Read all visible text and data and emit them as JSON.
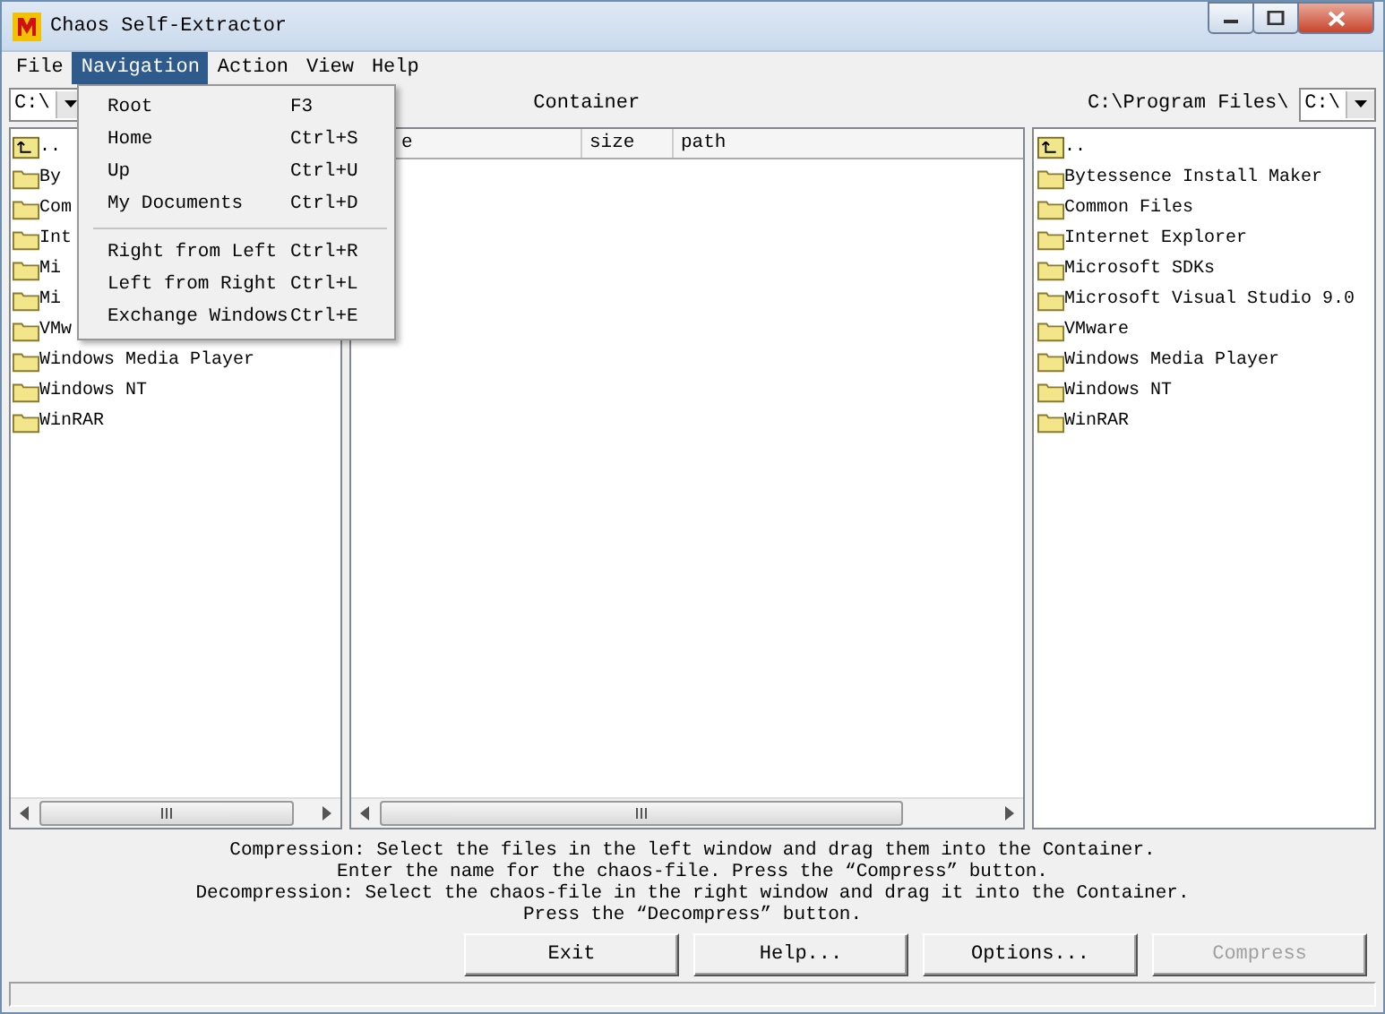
{
  "window": {
    "title": "Chaos Self-Extractor"
  },
  "menu_bar": [
    {
      "label": "File",
      "selected": false
    },
    {
      "label": "Navigation",
      "selected": true
    },
    {
      "label": "Action",
      "selected": false
    },
    {
      "label": "View",
      "selected": false
    },
    {
      "label": "Help",
      "selected": false
    }
  ],
  "open_menu": {
    "items": [
      {
        "kind": "item",
        "label": "Root",
        "shortcut": "F3"
      },
      {
        "kind": "item",
        "label": "Home",
        "shortcut": "Ctrl+S"
      },
      {
        "kind": "item",
        "label": "Up",
        "shortcut": "Ctrl+U"
      },
      {
        "kind": "item",
        "label": "My Documents",
        "shortcut": "Ctrl+D"
      },
      {
        "kind": "separator"
      },
      {
        "kind": "item",
        "label": "Right from Left",
        "shortcut": "Ctrl+R"
      },
      {
        "kind": "item",
        "label": "Left from Right",
        "shortcut": "Ctrl+L"
      },
      {
        "kind": "item",
        "label": "Exchange Windows",
        "shortcut": "Ctrl+E"
      }
    ]
  },
  "left_pane": {
    "drive": "C:\\",
    "items": [
      {
        "kind": "up",
        "label": ".."
      },
      {
        "kind": "folder",
        "label": "By"
      },
      {
        "kind": "folder",
        "label": "Com"
      },
      {
        "kind": "folder",
        "label": "Int"
      },
      {
        "kind": "folder",
        "label": "Mi"
      },
      {
        "kind": "folder",
        "label": "Mi"
      },
      {
        "kind": "folder",
        "label": "VMw"
      },
      {
        "kind": "folder",
        "label": "Windows Media Player"
      },
      {
        "kind": "folder",
        "label": "Windows NT"
      },
      {
        "kind": "folder",
        "label": "WinRAR"
      }
    ]
  },
  "container": {
    "title": "Container",
    "columns": [
      "e",
      "size",
      "path"
    ]
  },
  "right_pane": {
    "path": "C:\\Program Files\\",
    "drive": "C:\\",
    "items": [
      {
        "kind": "up",
        "label": ".."
      },
      {
        "kind": "folder",
        "label": "Bytessence Install Maker"
      },
      {
        "kind": "folder",
        "label": "Common Files"
      },
      {
        "kind": "folder",
        "label": "Internet Explorer"
      },
      {
        "kind": "folder",
        "label": "Microsoft SDKs"
      },
      {
        "kind": "folder",
        "label": "Microsoft Visual Studio 9.0"
      },
      {
        "kind": "folder",
        "label": "VMware"
      },
      {
        "kind": "folder",
        "label": "Windows Media Player"
      },
      {
        "kind": "folder",
        "label": "Windows NT"
      },
      {
        "kind": "folder",
        "label": "WinRAR"
      }
    ]
  },
  "instructions": [
    "Compression: Select the files in the left window and drag them into the Container.",
    "Enter the name for the chaos-file. Press the “Compress” button.",
    "Decompression: Select the chaos-file in the right window and drag it into the Container.",
    "Press the “Decompress” button."
  ],
  "buttons": [
    {
      "label": "Exit",
      "disabled": false
    },
    {
      "label": "Help...",
      "disabled": false
    },
    {
      "label": "Options...",
      "disabled": false
    },
    {
      "label": "Compress",
      "disabled": true
    }
  ]
}
